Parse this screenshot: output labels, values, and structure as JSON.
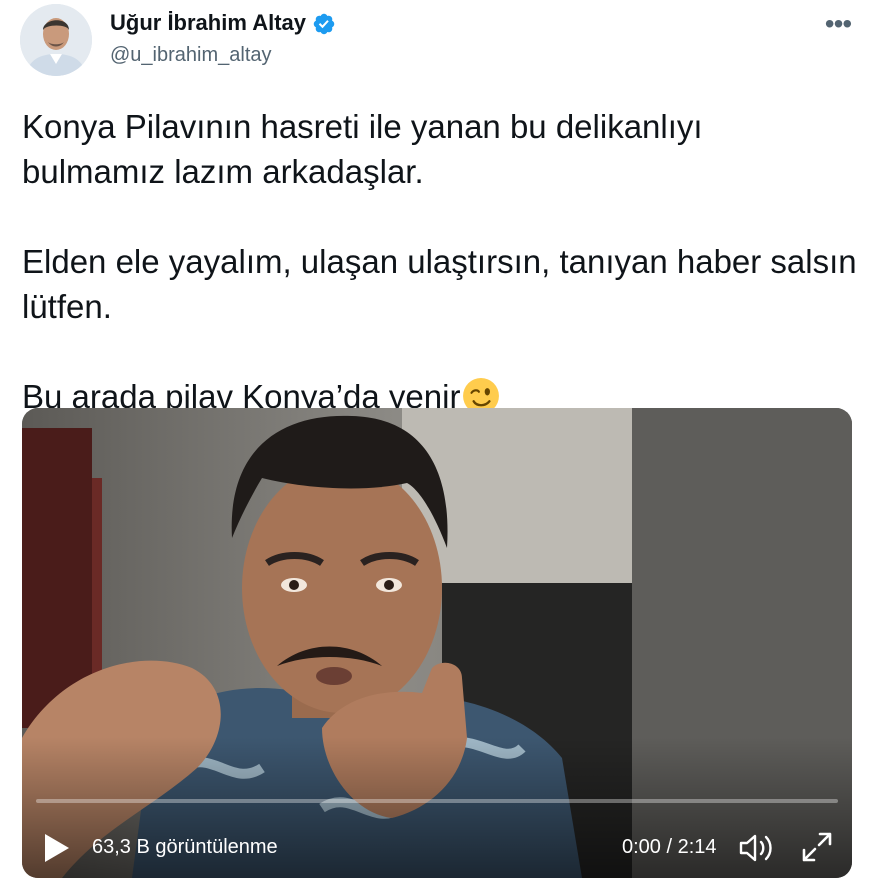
{
  "author": {
    "display_name": "Uğur İbrahim Altay",
    "handle": "@u_ibrahim_altay",
    "verified": true,
    "avatar_icon": "person-avatar-icon"
  },
  "menu": {
    "more_label": "•••"
  },
  "tweet": {
    "line1": "Konya Pilavının hasreti ile yanan bu delikanlıyı",
    "line2": "bulmamız lazım arkadaşlar.",
    "line3": "Elden ele yayalım, ulaşan ulaştırsın, tanıyan haber salsın",
    "line4": "lütfen.",
    "line5": "Bu arada pilav Konya’da yenir",
    "emoji": "winking-face"
  },
  "video": {
    "views": "63,3 B görüntülenme",
    "time": "0:00 / 2:14",
    "progress": 0.0,
    "controls": [
      "play-icon",
      "volume-icon",
      "fullscreen-icon"
    ]
  },
  "colors": {
    "text": "#0f1419",
    "secondary": "#536471",
    "verified": "#1d9bf0"
  }
}
